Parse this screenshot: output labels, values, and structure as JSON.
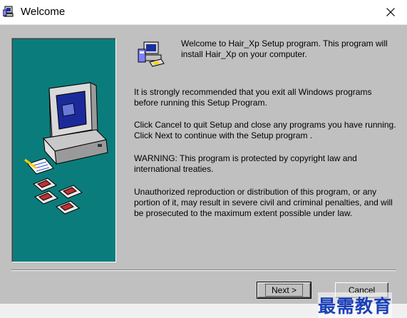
{
  "window": {
    "title": "Welcome",
    "close_glyph": "✕"
  },
  "content": {
    "intro": "Welcome to Hair_Xp Setup program. This program will install Hair_Xp on your computer.",
    "paragraphs": [
      "It is strongly recommended that you exit all Windows programs before running this Setup Program.",
      "Click Cancel to quit Setup and close any programs you have running.  Click Next to continue with the Setup program .",
      "WARNING: This program is protected by copyright law and international treaties.",
      "Unauthorized reproduction or distribution of this program, or any portion of it, may result in severe civil and criminal penalties, and will be prosecuted to the maximum extent possible under law."
    ]
  },
  "buttons": {
    "next": "Next >",
    "cancel": "Cancel"
  },
  "watermark": "最需教育",
  "colors": {
    "panel": "#0b7c7c",
    "dialog": "#c0c0c0",
    "watermark": "#1a3fb8"
  },
  "icons": {
    "app": "setup-computer-icon",
    "close": "close-icon",
    "illustration": "computer-with-disks-illustration",
    "setup": "setup-computer-icon"
  }
}
